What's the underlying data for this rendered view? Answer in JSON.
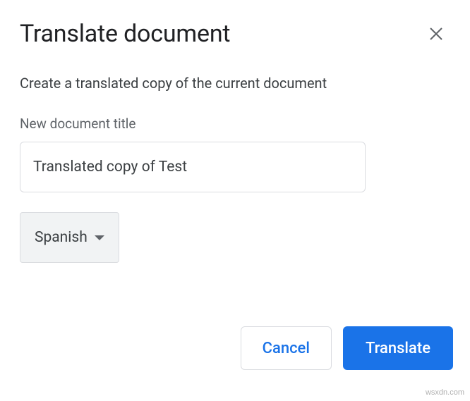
{
  "dialog": {
    "title": "Translate document",
    "description": "Create a translated copy of the current document",
    "title_field": {
      "label": "New document title",
      "value": "Translated copy of Test"
    },
    "language": {
      "selected": "Spanish"
    },
    "buttons": {
      "cancel": "Cancel",
      "translate": "Translate"
    }
  },
  "watermark": "wsxdn.com"
}
